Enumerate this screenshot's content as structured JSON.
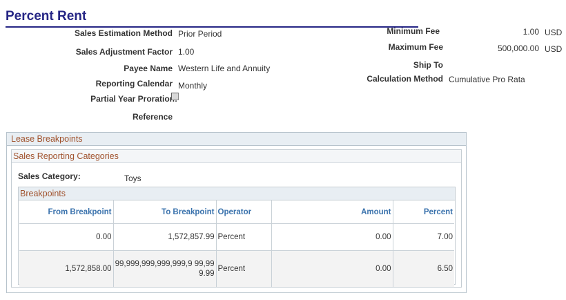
{
  "page": {
    "title": "Percent Rent"
  },
  "fields_left": [
    {
      "label": "Sales Estimation Method",
      "value": "Prior Period"
    },
    {
      "label": "Sales Adjustment Factor",
      "value": "1.00"
    },
    {
      "label": "Payee Name",
      "value": "Western Life and Annuity"
    },
    {
      "label": "Reporting Calendar",
      "value": "Monthly"
    },
    {
      "label": "Partial Year Proration:",
      "checked": false
    },
    {
      "label": "Reference",
      "value": ""
    }
  ],
  "fields_right": {
    "minimum_fee": {
      "label": "Minimum Fee",
      "value": "1.00",
      "currency": "USD"
    },
    "maximum_fee": {
      "label": "Maximum Fee",
      "value": "500,000.00",
      "currency": "USD"
    },
    "ship_to": {
      "label": "Ship To",
      "value": ""
    },
    "calculation_method": {
      "label": "Calculation Method",
      "value": "Cumulative Pro Rata"
    }
  },
  "lease_breakpoints": {
    "title": "Lease Breakpoints",
    "sales_reporting_categories": {
      "title": "Sales Reporting Categories",
      "sales_category_label": "Sales Category:",
      "sales_category_value": "Toys",
      "breakpoints": {
        "title": "Breakpoints",
        "columns": [
          "From Breakpoint",
          "To Breakpoint",
          "Operator",
          "Amount",
          "Percent"
        ],
        "rows": [
          {
            "from": "0.00",
            "to": "1,572,857.99",
            "operator": "Percent",
            "amount": "0.00",
            "percent": "7.00"
          },
          {
            "from": "1,572,858.00",
            "to": "99,999,999,999,999,9 99,999.99",
            "operator": "Percent",
            "amount": "0.00",
            "percent": "6.50"
          }
        ]
      }
    }
  },
  "colors": {
    "title": "#262685",
    "group_title": "#a0522d",
    "column_header": "#3b73ad",
    "group_border": "#b7c3cc"
  }
}
